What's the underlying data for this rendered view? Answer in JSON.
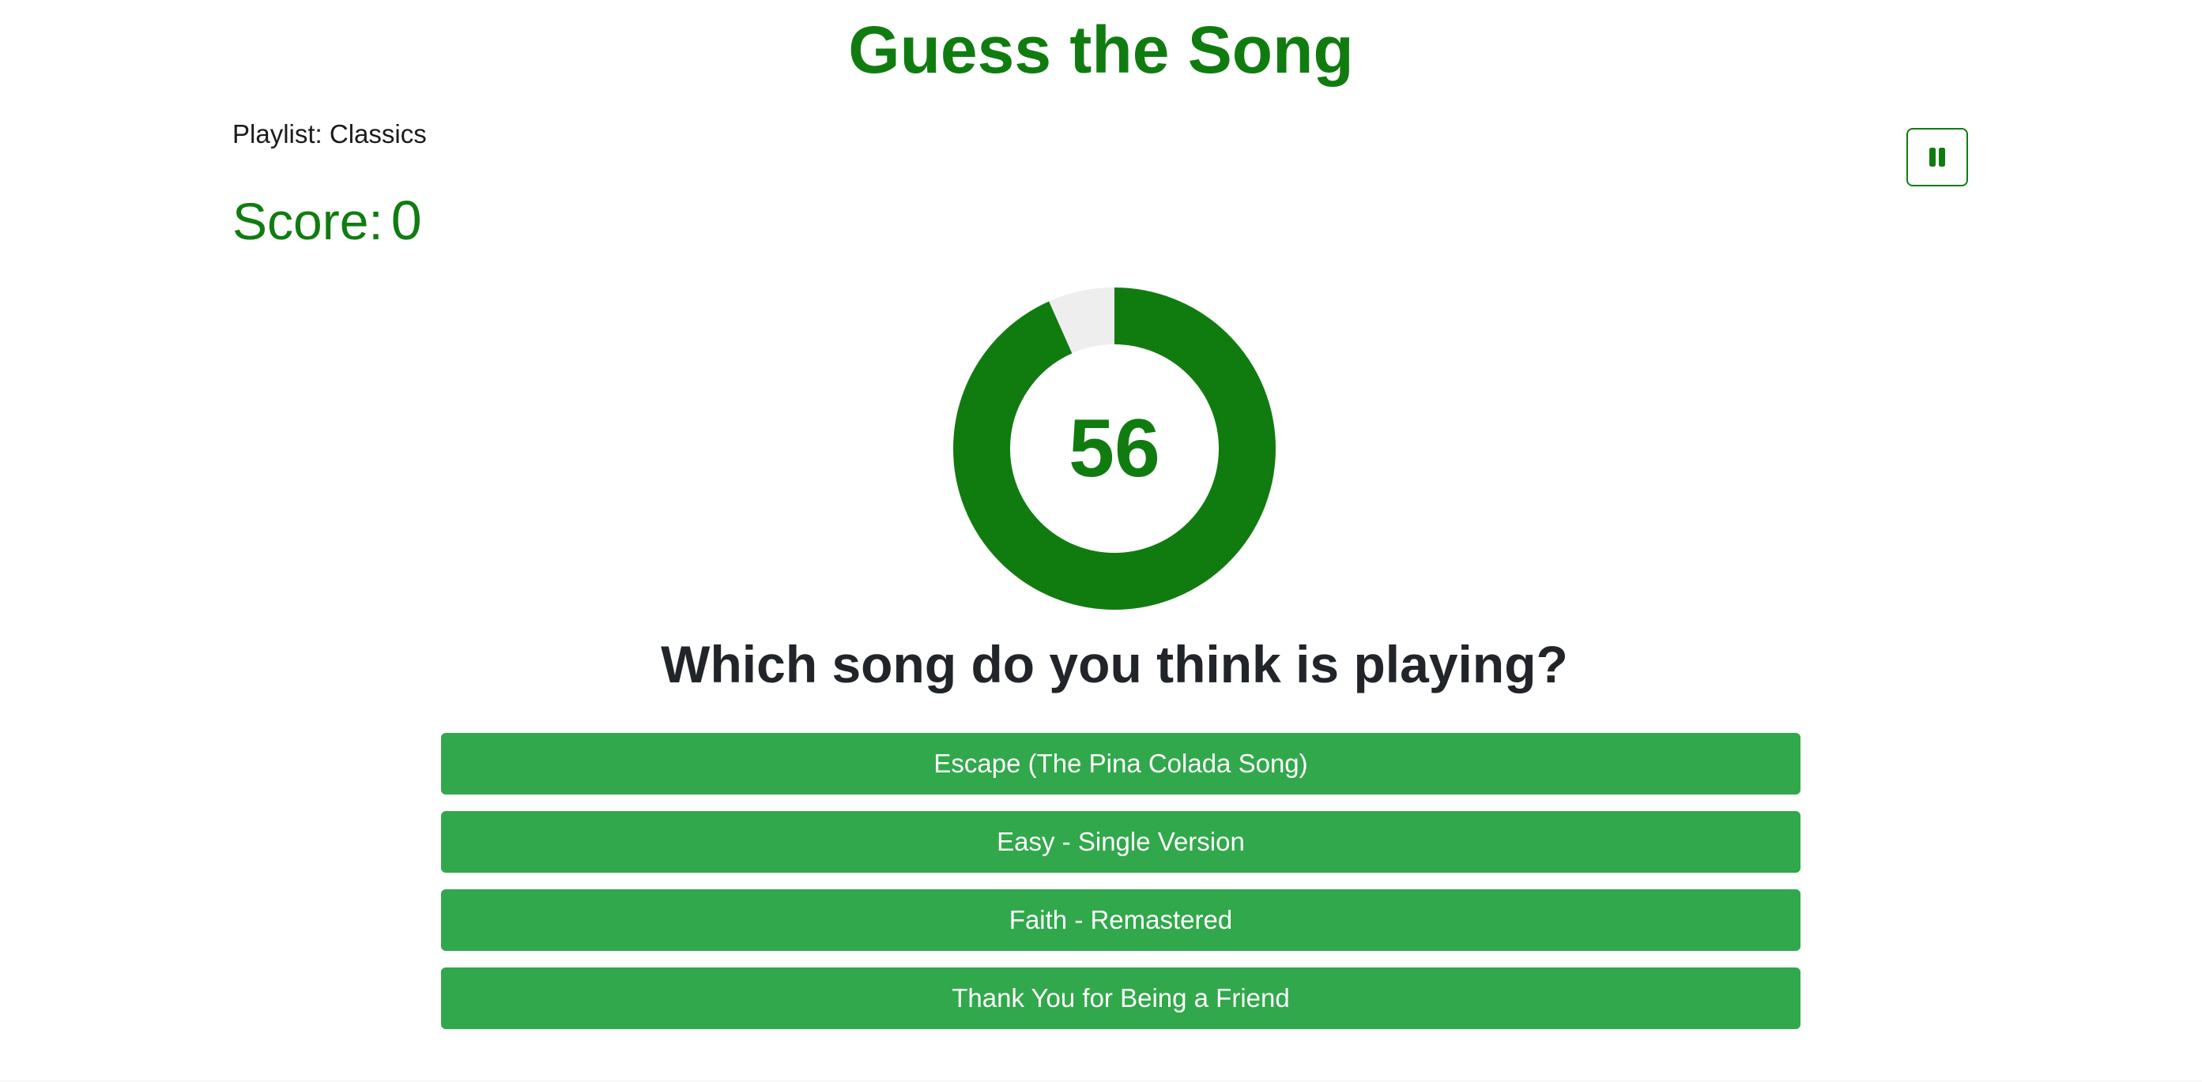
{
  "header": {
    "title": "Guess the Song"
  },
  "playlist": {
    "label": "Playlist: Classics"
  },
  "score": {
    "label": "Score:",
    "value": "0"
  },
  "controls": {
    "pause_icon": "pause-icon"
  },
  "timer": {
    "value": "56",
    "progress_fraction": 0.933,
    "colors": {
      "filled": "#107c10",
      "remaining": "#eeeeee"
    }
  },
  "question": {
    "text": "Which song do you think is playing?"
  },
  "answers": [
    {
      "label": "Escape (The Pina Colada Song)"
    },
    {
      "label": "Easy - Single Version"
    },
    {
      "label": "Faith - Remastered"
    },
    {
      "label": "Thank You for Being a Friend"
    }
  ],
  "colors": {
    "accent": "#107c10",
    "button": "#31a84b",
    "button_text": "#ffffff",
    "question_text": "#212529"
  }
}
